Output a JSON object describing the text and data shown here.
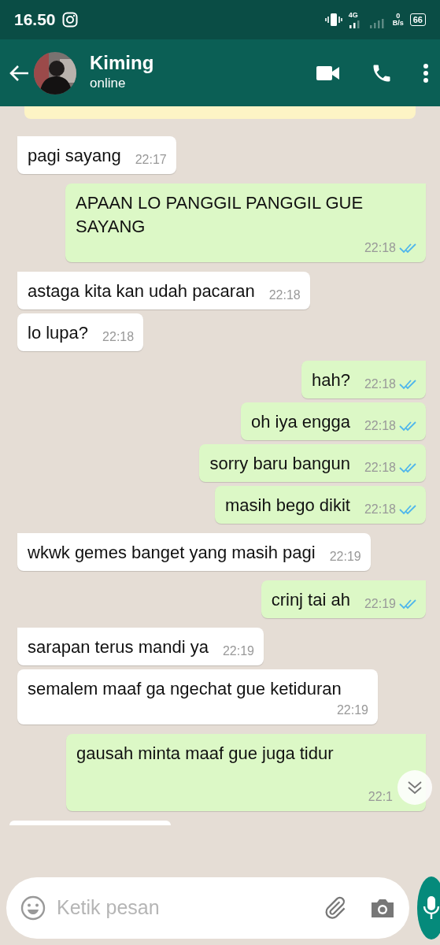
{
  "status_bar": {
    "time": "16.50",
    "network": "4G",
    "speed_value": "0",
    "speed_unit": "B/s",
    "battery": "66"
  },
  "header": {
    "name": "Kiming",
    "status": "online"
  },
  "messages": [
    {
      "kind": "incoming",
      "text": "pagi sayang",
      "time": "22:17",
      "tail": true
    },
    {
      "kind": "outgoing",
      "text": "APAAN LO PANGGIL PANGGIL GUE SAYANG",
      "time": "22:18",
      "read": true,
      "tail": true
    },
    {
      "kind": "incoming",
      "text": "astaga kita kan udah pacaran",
      "time": "22:18",
      "tail": true
    },
    {
      "kind": "incoming",
      "text": "lo lupa?",
      "time": "22:18",
      "tail": false
    },
    {
      "kind": "outgoing",
      "text": "hah?",
      "time": "22:18",
      "read": true,
      "tail": true
    },
    {
      "kind": "outgoing",
      "text": "oh iya engga",
      "time": "22:18",
      "read": true,
      "tail": false
    },
    {
      "kind": "outgoing",
      "text": "sorry baru bangun",
      "time": "22:18",
      "read": true,
      "tail": false
    },
    {
      "kind": "outgoing",
      "text": "masih bego dikit",
      "time": "22:18",
      "read": true,
      "tail": false
    },
    {
      "kind": "incoming",
      "text": "wkwk gemes banget yang masih pagi",
      "time": "22:19",
      "tail": true
    },
    {
      "kind": "outgoing",
      "text": "crinj tai ah",
      "time": "22:19",
      "read": true,
      "tail": true
    },
    {
      "kind": "incoming",
      "text": "sarapan terus mandi ya",
      "time": "22:19",
      "tail": true
    },
    {
      "kind": "incoming",
      "text": "semalem maaf ga ngechat gue ketiduran",
      "time": "22:19",
      "tail": false
    },
    {
      "kind": "outgoing",
      "text": "gausah minta maaf gue juga tidur",
      "time": "22:1",
      "tail": true
    }
  ],
  "composer": {
    "placeholder": "Ketik pesan"
  }
}
